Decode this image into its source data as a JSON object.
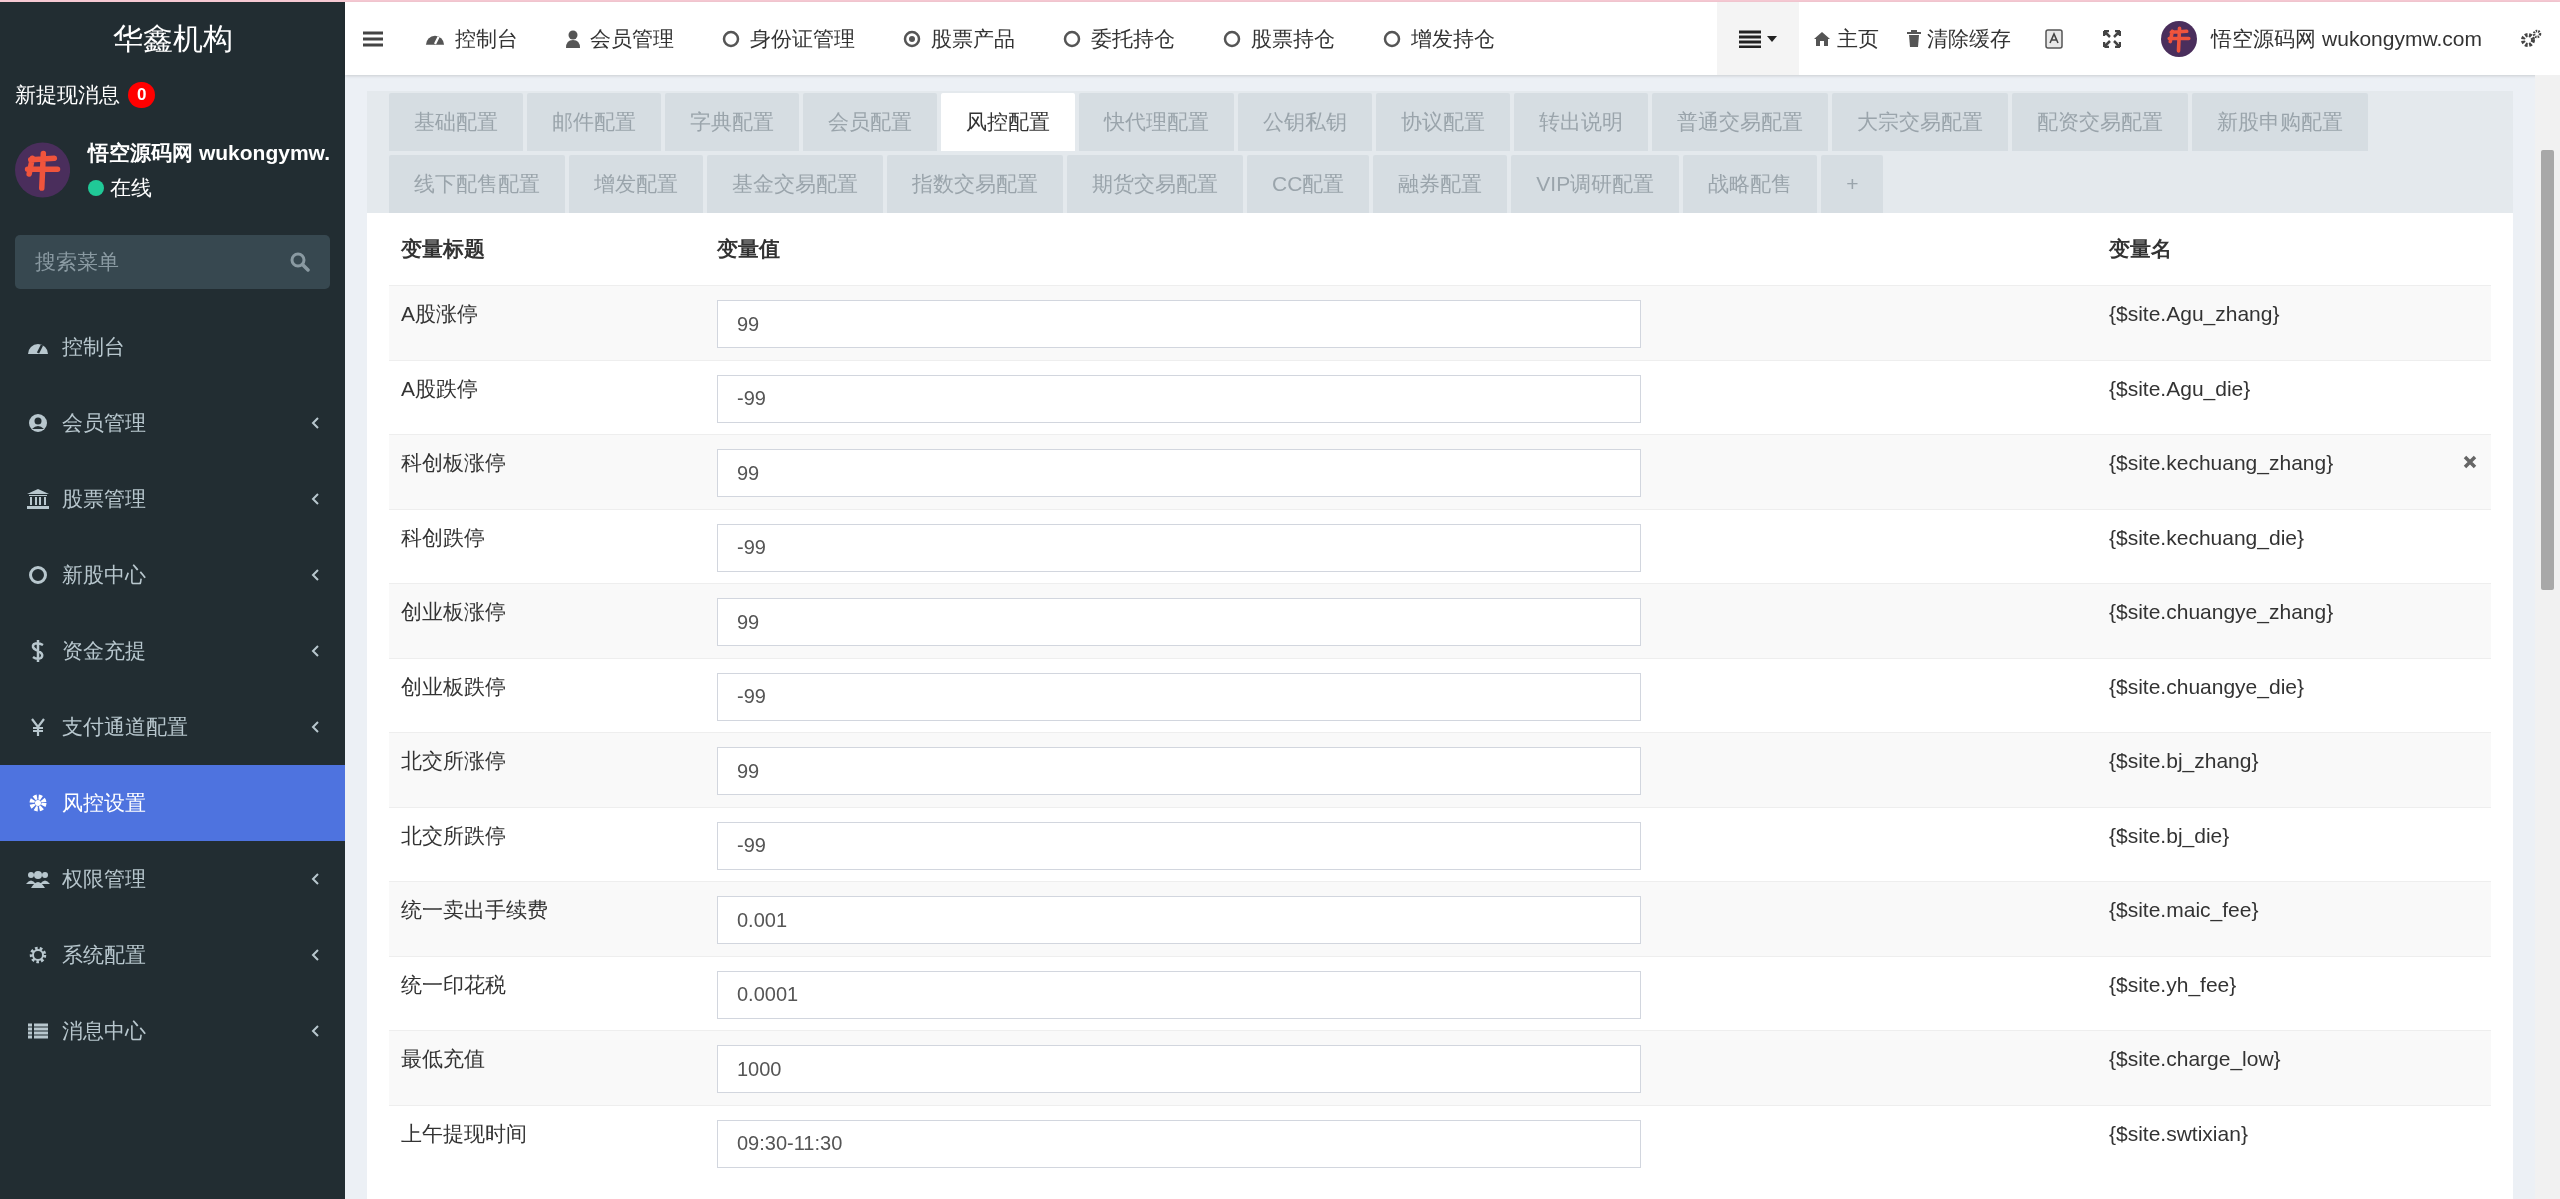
{
  "sidebar": {
    "title": "华鑫机构",
    "notice": {
      "label": "新提现消息",
      "count": "0"
    },
    "user": {
      "name": "悟空源码网 wukongymw.",
      "status": "在线",
      "online": true
    },
    "search": {
      "placeholder": "搜索菜单"
    },
    "items": [
      {
        "label": "控制台",
        "has_submenu": false,
        "selected": false
      },
      {
        "label": "会员管理",
        "has_submenu": true,
        "selected": false
      },
      {
        "label": "股票管理",
        "has_submenu": true,
        "selected": false
      },
      {
        "label": "新股中心",
        "has_submenu": true,
        "selected": false
      },
      {
        "label": "资金充提",
        "has_submenu": true,
        "selected": false
      },
      {
        "label": "支付通道配置",
        "has_submenu": true,
        "selected": false
      },
      {
        "label": "风控设置",
        "has_submenu": false,
        "selected": true
      },
      {
        "label": "权限管理",
        "has_submenu": true,
        "selected": false
      },
      {
        "label": "系统配置",
        "has_submenu": true,
        "selected": false
      },
      {
        "label": "消息中心",
        "has_submenu": true,
        "selected": false
      }
    ]
  },
  "topbar": {
    "nav": [
      {
        "label": "控制台"
      },
      {
        "label": "会员管理"
      },
      {
        "label": "身份证管理"
      },
      {
        "label": "股票产品"
      },
      {
        "label": "委托持仓"
      },
      {
        "label": "股票持仓"
      },
      {
        "label": "增发持仓"
      }
    ],
    "actions": [
      {
        "label": "主页"
      },
      {
        "label": "清除缓存"
      }
    ],
    "user": "悟空源码网 wukongymw.com"
  },
  "tabs": [
    {
      "label": "基础配置",
      "selected": false
    },
    {
      "label": "邮件配置",
      "selected": false
    },
    {
      "label": "字典配置",
      "selected": false
    },
    {
      "label": "会员配置",
      "selected": false
    },
    {
      "label": "风控配置",
      "selected": true
    },
    {
      "label": "快代理配置",
      "selected": false
    },
    {
      "label": "公钥私钥",
      "selected": false
    },
    {
      "label": "协议配置",
      "selected": false
    },
    {
      "label": "转出说明",
      "selected": false
    },
    {
      "label": "普通交易配置",
      "selected": false
    },
    {
      "label": "大宗交易配置",
      "selected": false
    },
    {
      "label": "配资交易配置",
      "selected": false
    },
    {
      "label": "新股申购配置",
      "selected": false
    },
    {
      "label": "线下配售配置",
      "selected": false
    },
    {
      "label": "增发配置",
      "selected": false
    },
    {
      "label": "基金交易配置",
      "selected": false
    },
    {
      "label": "指数交易配置",
      "selected": false
    },
    {
      "label": "期货交易配置",
      "selected": false
    },
    {
      "label": "CC配置",
      "selected": false
    },
    {
      "label": "融券配置",
      "selected": false
    },
    {
      "label": "VIP调研配置",
      "selected": false
    },
    {
      "label": "战略配售",
      "selected": false
    },
    {
      "label": "+",
      "selected": false
    }
  ],
  "table": {
    "columns": [
      "变量标题",
      "变量值",
      "变量名"
    ],
    "rows": [
      {
        "title": "A股涨停",
        "value": "99",
        "name": "{$site.Agu_zhang}",
        "hovered": false
      },
      {
        "title": "A股跌停",
        "value": "-99",
        "name": "{$site.Agu_die}",
        "hovered": false
      },
      {
        "title": "科创板涨停",
        "value": "99",
        "name": "{$site.kechuang_zhang}",
        "hovered": true
      },
      {
        "title": "科创跌停",
        "value": "-99",
        "name": "{$site.kechuang_die}",
        "hovered": false
      },
      {
        "title": "创业板涨停",
        "value": "99",
        "name": "{$site.chuangye_zhang}",
        "hovered": false
      },
      {
        "title": "创业板跌停",
        "value": "-99",
        "name": "{$site.chuangye_die}",
        "hovered": false
      },
      {
        "title": "北交所涨停",
        "value": "99",
        "name": "{$site.bj_zhang}",
        "hovered": false
      },
      {
        "title": "北交所跌停",
        "value": "-99",
        "name": "{$site.bj_die}",
        "hovered": false
      },
      {
        "title": "统一卖出手续费",
        "value": "0.001",
        "name": "{$site.maic_fee}",
        "hovered": false
      },
      {
        "title": "统一印花税",
        "value": "0.0001",
        "name": "{$site.yh_fee}",
        "hovered": false
      },
      {
        "title": "最低充值",
        "value": "1000",
        "name": "{$site.charge_low}",
        "hovered": false
      },
      {
        "title": "上午提现时间",
        "value": "09:30-11:30",
        "name": "{$site.swtixian}",
        "hovered": false
      }
    ]
  }
}
